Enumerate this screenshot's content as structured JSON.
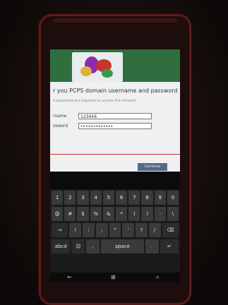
{
  "dialog": {
    "title": "r you PCPS domain username and password",
    "subtitle": "d password are required to access the network",
    "username_label": "rname",
    "username_value": "123456",
    "password_label": "ssword",
    "password_value": "•••••••••••••",
    "signin_label": "Continue"
  },
  "keyboard": {
    "row1": [
      "1",
      "2",
      "3",
      "4",
      "5",
      "6",
      "7",
      "8",
      "9",
      "0"
    ],
    "row2": [
      "@",
      "#",
      "$",
      "%",
      "&",
      "*",
      "(",
      ")",
      "-",
      "\\"
    ],
    "row3": [
      "→",
      "!",
      ":",
      ";",
      "\"",
      "'",
      "?",
      "/",
      "⌫"
    ],
    "row4": {
      "abcd": "abcd",
      "emoji": "☺",
      "comma": ",",
      "space": "space",
      "period": ".",
      "enter": "↵"
    }
  },
  "navbar": {
    "back": "←",
    "start": "⊞",
    "search": "⌕"
  },
  "colors": {
    "phone_frame": "#5a1c1a",
    "header_green": "#2f6f3f",
    "accent_red": "#d22f2f",
    "button_blue": "#566a86"
  }
}
